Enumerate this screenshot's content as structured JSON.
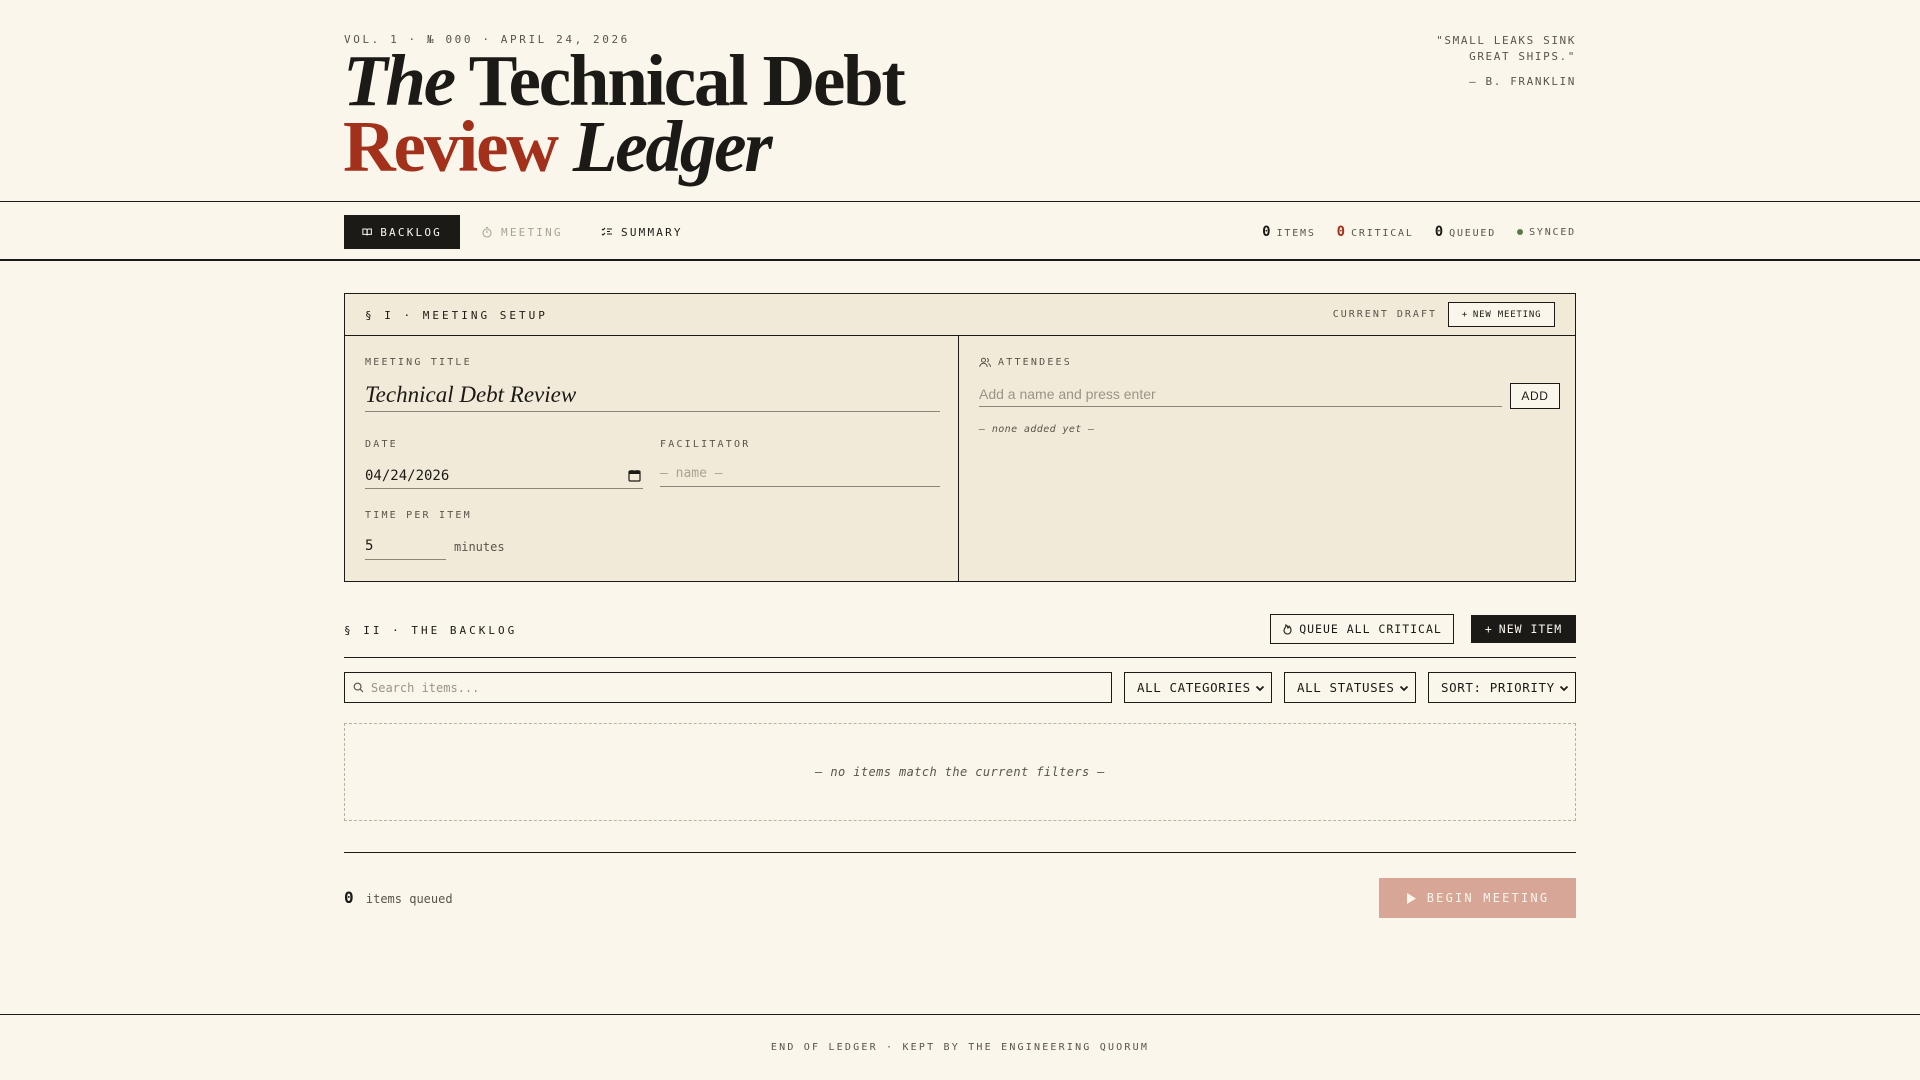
{
  "masthead": {
    "issue_line": "VOL. 1 · № 000 · APRIL 24, 2026",
    "title_the": "The",
    "title_technical_debt": "Technical Debt",
    "title_review": "Review",
    "title_ledger": "Ledger",
    "quote_line1": "\"SMALL LEAKS SINK",
    "quote_line2": "GREAT SHIPS.\"",
    "quote_attribution": "— B. FRANKLIN",
    "accent_color": "#a2301a"
  },
  "nav": {
    "tabs": [
      {
        "label": "BACKLOG",
        "icon": "book-icon",
        "state": "active"
      },
      {
        "label": "MEETING",
        "icon": "timer-icon",
        "state": "disabled"
      },
      {
        "label": "SUMMARY",
        "icon": "checklist-icon",
        "state": "normal"
      }
    ],
    "stats": {
      "items_count": "0",
      "items_label": "ITEMS",
      "critical_count": "0",
      "critical_label": "CRITICAL",
      "queued_count": "0",
      "queued_label": "QUEUED",
      "sync_status": "SYNCED"
    }
  },
  "setup": {
    "section_label": "§ I · MEETING SETUP",
    "draft_label": "CURRENT DRAFT",
    "new_meeting_label": "NEW MEETING",
    "meeting_title_label": "MEETING TITLE",
    "meeting_title_value": "Technical Debt Review",
    "date_label": "DATE",
    "date_value": "04/24/2026",
    "facilitator_label": "FACILITATOR",
    "facilitator_placeholder": "— name —",
    "time_label": "TIME PER ITEM",
    "time_value": "5",
    "time_unit": "minutes",
    "attendees_label": "ATTENDEES",
    "attendee_placeholder": "Add a name and press enter",
    "add_label": "ADD",
    "attendees_empty": "— none added yet —"
  },
  "backlog": {
    "section_label": "§ II · THE BACKLOG",
    "queue_all_label": "QUEUE ALL CRITICAL",
    "new_item_label": "NEW ITEM",
    "search_placeholder": "Search items...",
    "category_filter": "ALL CATEGORIES",
    "status_filter": "ALL STATUSES",
    "sort_filter": "SORT: PRIORITY",
    "empty_message": "— no items match the current filters —",
    "queued_count": "0",
    "queued_label": "items queued",
    "begin_label": "BEGIN MEETING"
  },
  "footer": {
    "text": "END OF LEDGER · KEPT BY THE ENGINEERING QUORUM"
  }
}
